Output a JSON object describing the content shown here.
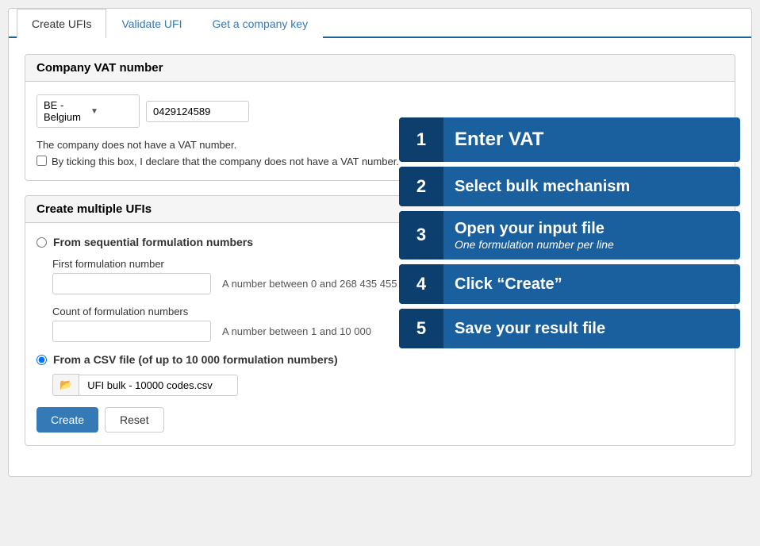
{
  "tabs": [
    {
      "id": "create-ufis",
      "label": "Create UFIs",
      "active": true
    },
    {
      "id": "validate-ufi",
      "label": "Validate UFI",
      "active": false
    },
    {
      "id": "get-company-key",
      "label": "Get a company key",
      "active": false
    }
  ],
  "vat_section": {
    "title": "Company VAT number",
    "country_default": "BE - Belgium",
    "vat_value": "0429124589",
    "no_vat_note": "The company does not have a VAT number.",
    "checkbox_label": "By ticking this box, I declare that the company does not have a VAT number."
  },
  "ufi_section": {
    "title": "Create multiple UFIs",
    "sequential_label": "From sequential formulation numbers",
    "first_number_label": "First formulation number",
    "first_number_hint": "A number between 0 and 268 435 455",
    "count_label": "Count of formulation numbers",
    "count_hint": "A number between 1 and 10 000",
    "csv_label": "From a CSV file (of up to 10 000 formulation numbers)",
    "file_icon": "📂",
    "file_name": "UFI bulk - 10000 codes.csv"
  },
  "buttons": {
    "create": "Create",
    "reset": "Reset"
  },
  "steps": [
    {
      "number": "1",
      "text": "Enter VAT",
      "sub": null
    },
    {
      "number": "2",
      "text": "Select bulk mechanism",
      "sub": null
    },
    {
      "number": "3",
      "text": "Open your input file",
      "sub": "One formulation number per line"
    },
    {
      "number": "4",
      "text": "Click “Create”",
      "sub": null
    },
    {
      "number": "5",
      "text": "Save your result file",
      "sub": null
    }
  ]
}
